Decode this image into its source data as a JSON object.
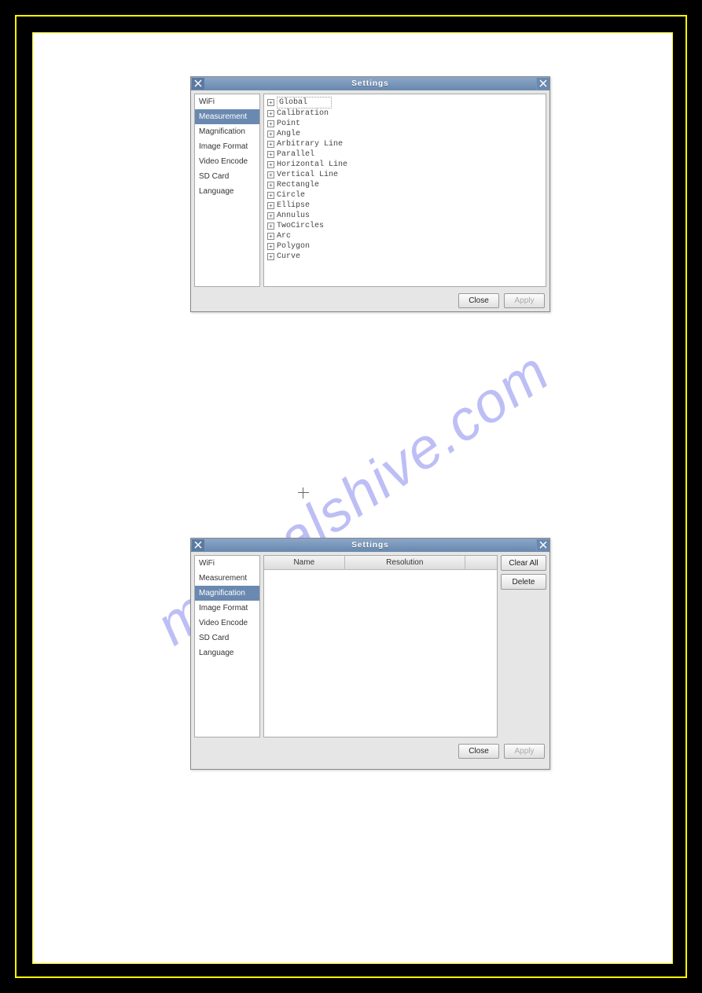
{
  "watermark": "manualshive.com",
  "dialog1": {
    "title": "Settings",
    "sidebar": [
      {
        "label": "WiFi",
        "selected": false
      },
      {
        "label": "Measurement",
        "selected": true
      },
      {
        "label": "Magnification",
        "selected": false
      },
      {
        "label": "Image Format",
        "selected": false
      },
      {
        "label": "Video Encode",
        "selected": false
      },
      {
        "label": "SD Card",
        "selected": false
      },
      {
        "label": "Language",
        "selected": false
      }
    ],
    "tree": [
      "Global",
      "Calibration",
      "Point",
      "Angle",
      "Arbitrary Line",
      "Parallel",
      "Horizontal Line",
      "Vertical Line",
      "Rectangle",
      "Circle",
      "Ellipse",
      "Annulus",
      "TwoCircles",
      "Arc",
      "Polygon",
      "Curve"
    ],
    "buttons": {
      "close": "Close",
      "apply": "Apply"
    }
  },
  "dialog2": {
    "title": "Settings",
    "sidebar": [
      {
        "label": "WiFi",
        "selected": false
      },
      {
        "label": "Measurement",
        "selected": false
      },
      {
        "label": "Magnification",
        "selected": true
      },
      {
        "label": "Image Format",
        "selected": false
      },
      {
        "label": "Video Encode",
        "selected": false
      },
      {
        "label": "SD Card",
        "selected": false
      },
      {
        "label": "Language",
        "selected": false
      }
    ],
    "columns": {
      "name": "Name",
      "resolution": "Resolution",
      "blank": ""
    },
    "side_buttons": {
      "clear_all": "Clear All",
      "delete": "Delete"
    },
    "buttons": {
      "close": "Close",
      "apply": "Apply"
    }
  }
}
